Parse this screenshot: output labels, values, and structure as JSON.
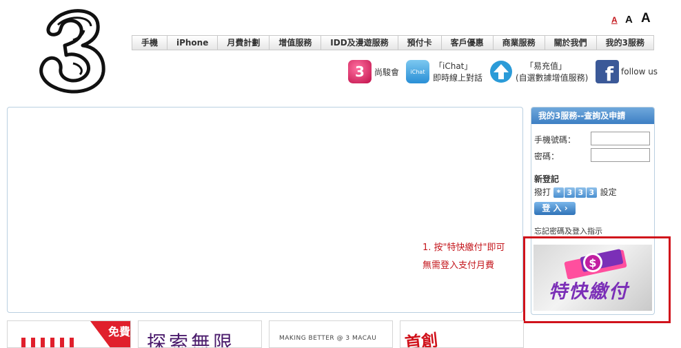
{
  "font_size": {
    "small": "A",
    "medium": "A",
    "large": "A"
  },
  "nav": [
    "手機",
    "iPhone",
    "月費計劃",
    "增值服務",
    "IDD及漫遊服務",
    "預付卡",
    "客戶優惠",
    "商業服務",
    "關於我們",
    "我的3服務"
  ],
  "quick_links": {
    "shang_hui": "尚駿會",
    "ichat_title": "「iChat」",
    "ichat_sub": "即時線上對話",
    "ichat_icon_label": "iChat",
    "yichongzhi_title": "「易充值」",
    "yichongzhi_sub": "(自選數據增值服務)",
    "facebook": "follow us"
  },
  "main": {
    "note_line1": "1. 按\"特快繳付\"即可",
    "note_line2": "無需登入支付月費"
  },
  "service": {
    "title": "我的3服務--查詢及申請",
    "phone_label": "手機號碼：",
    "password_label": "密碼：",
    "register_title": "新登記",
    "dial_label": "撥打",
    "dial_keys": [
      "*",
      "3",
      "3",
      "3"
    ],
    "setup_label": "設定",
    "login_button": "登 入",
    "forgot": "忘記密碼及登入指示",
    "banner_text": "特快繳付"
  },
  "promos": {
    "p1_badge": "免費",
    "p2_text": "探索無限",
    "p3_text": "MAKING BETTER @ 3 MACAU",
    "p4_text": "首創"
  },
  "colors": {
    "accent": "#3d7fc4",
    "alert": "#c4161c",
    "highlight": "#d0121b",
    "banner": "#7b2fb7"
  }
}
